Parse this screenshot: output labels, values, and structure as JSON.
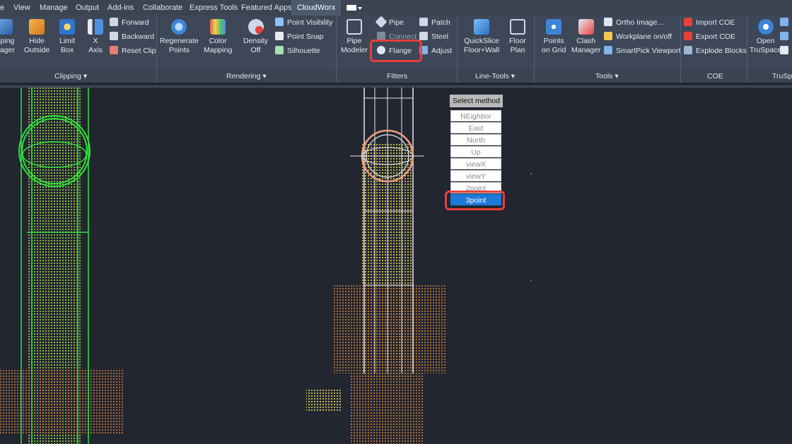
{
  "tabs": [
    "e",
    "View",
    "Manage",
    "Output",
    "Add-ins",
    "Collaborate",
    "Express Tools",
    "Featured Apps",
    "CloudWorx"
  ],
  "active_tab": "CloudWorx",
  "clipping": {
    "btn1": "pping\nnager",
    "hide": "Hide\nOutside",
    "limit": "Limit\nBox",
    "xaxis": "X\nAxis",
    "forward": "Forward",
    "backward": "Backward",
    "reset": "Reset Clip",
    "panel": "Clipping"
  },
  "rendering": {
    "regen": "Regenerate\nPoints",
    "color": "Color\nMapping",
    "density": "Density\nOff",
    "visibility": "Point Visibility",
    "snap": "Point Snap",
    "silhouette": "Silhouette",
    "panel": "Rendering"
  },
  "fitters": {
    "pipe_modeler": "Pipe\nModeler",
    "pipe": "Pipe",
    "connect": "Connect",
    "flange": "Flange",
    "patch": "Patch",
    "steel": "Steel",
    "adjust": "Adjust",
    "panel": "Fitters"
  },
  "linetools": {
    "quickslice": "QuickSlice\nFloor+Wall",
    "floorplan": "Floor\nPlan",
    "panel": "Line-Tools"
  },
  "tools": {
    "points_grid": "Points\non Grid",
    "clash": "Clash\nManager",
    "ortho": "Ortho Image...",
    "workplane": "Workplane on/off",
    "smartpick": "SmartPick Viewport",
    "panel": "Tools"
  },
  "coe": {
    "import": "Import COE",
    "export": "Export COE",
    "explode": "Explode Blocks",
    "panel": "COE"
  },
  "truspace": {
    "open": "Open\nTruSpace",
    "panel": "TruSpa"
  },
  "select_menu": {
    "title": "Select method",
    "items": [
      "NEighbor",
      "East",
      "North",
      "Up",
      "viewX",
      "viewY",
      "2point",
      "3point"
    ],
    "selected": "3point"
  },
  "colors": {
    "highlight": "#e8403a",
    "selected": "#1d79d8",
    "ribbon": "#3d4758",
    "viewport": "#212631"
  }
}
